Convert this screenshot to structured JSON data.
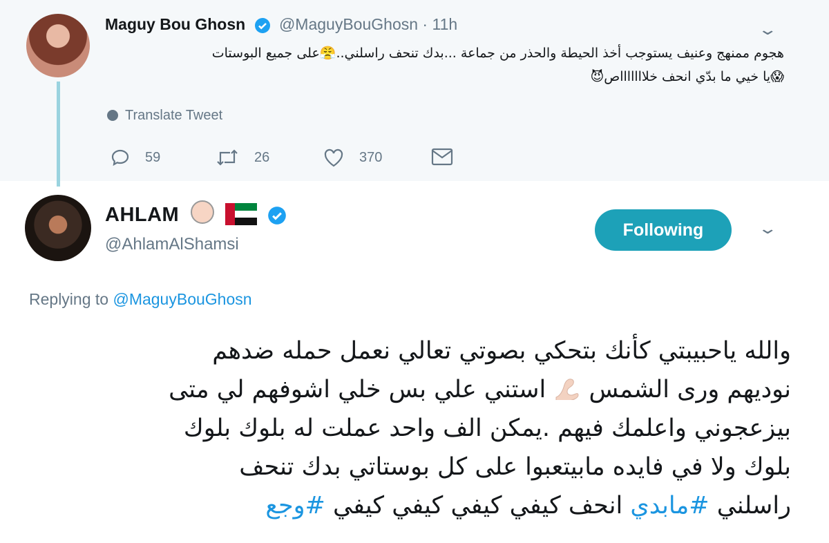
{
  "parent_tweet": {
    "display_name": "Maguy Bou Ghosn",
    "handle": "@MaguyBouGhosn",
    "separator": "·",
    "time": "11h",
    "text_line1": "هجوم ممنهج وعنيف يستوجب أخذ الحيطة والحذر من جماعة ...بدك تنحف راسلني..😤على جميع البوستات",
    "text_line2": "😱يا خيي ما بدّي انحف خلاااااااص😈",
    "translate_label": "Translate Tweet",
    "replies": "59",
    "retweets": "26",
    "likes": "370"
  },
  "reply_tweet": {
    "display_name": "AHLAM",
    "handle": "@AhlamAlShamsi",
    "follow_label": "Following",
    "replying_prefix": "Replying to",
    "replying_to": "@MaguyBouGhosn",
    "line1": "والله ياحبيبتي كأنك بتحكي بصوتي تعالي نعمل حمله ضدهم",
    "line2a": "نوديهم ورى الشمس",
    "line2b": "استني علي بس خلي اشوفهم لي متى",
    "line3": "بيزعجوني واعلمك فيهم .يمكن الف واحد عملت له بلوك بلوك",
    "line4": "بلوك ولا في فايده مابيتعبوا على كل بوستاتي بدك تنحف",
    "line5_a": "راسلني",
    "hashtag1": "#مابدي",
    "line5_b": "انحف كيفي كيفي كيفي كيفي",
    "hashtag2": "#وجع"
  },
  "colors": {
    "accent": "#1da1b8",
    "link": "#1b95e0",
    "muted": "#657786",
    "thread": "#9ad3df"
  },
  "icons": [
    "verified-badge-icon",
    "chevron-down-icon",
    "globe-icon",
    "reply-icon",
    "retweet-icon",
    "like-icon",
    "message-icon",
    "woman-emoji-icon",
    "uae-flag-icon",
    "flexed-arm-emoji-icon"
  ]
}
